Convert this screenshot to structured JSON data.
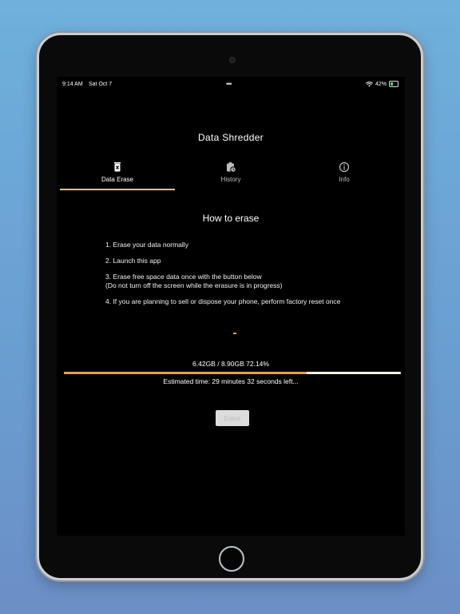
{
  "status_bar": {
    "time": "9:14 AM",
    "date": "Sat Oct 7",
    "multitask_dots": "•••",
    "battery": "42%",
    "battery_level": 0.42
  },
  "app": {
    "title": "Data Shredder"
  },
  "tabs": [
    {
      "label": "Data Erase",
      "icon": "trash-icon",
      "active": true
    },
    {
      "label": "History",
      "icon": "clipboard-clock-icon",
      "active": false
    },
    {
      "label": "Info",
      "icon": "info-icon",
      "active": false
    }
  ],
  "main": {
    "heading": "How to erase",
    "steps": [
      "1. Erase your data normally",
      "2. Launch this app",
      "3. Erase free space data once with the button below",
      "(Do not turn off the screen while the erasure is in progress)",
      "4. If you are planning to sell or dispose your phone, perform factory reset once"
    ],
    "progress_text": "6.42GB / 8.90GB 72.14%",
    "progress_fraction": 0.7214,
    "estimate": "Estimated time: 29 minutes 32 seconds left...",
    "erase_button": "Erase"
  },
  "colors": {
    "accent": "#e6c46a",
    "progress_fill": "#e6a14e",
    "background": "#000000"
  }
}
